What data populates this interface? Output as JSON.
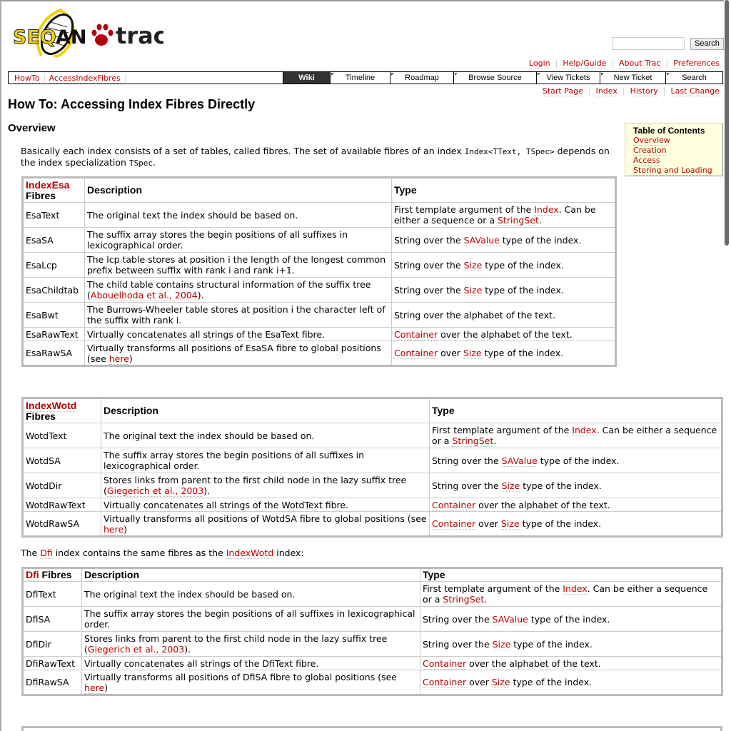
{
  "logo": {
    "text": "SEQAN trac",
    "colors": {
      "yellow": "#f5d000",
      "red": "#b5000d"
    }
  },
  "header": {
    "search_placeholder": "",
    "search_button": "Search"
  },
  "metanav": [
    "Login",
    "Help/Guide",
    "About Trac",
    "Preferences"
  ],
  "breadcrumbs": [
    "HowTo",
    "AccessIndexFibres"
  ],
  "mainnav": [
    {
      "label": "Wiki",
      "active": true
    },
    {
      "label": "Timeline"
    },
    {
      "label": "Roadmap"
    },
    {
      "label": "Browse Source"
    },
    {
      "label": "View Tickets"
    },
    {
      "label": "New Ticket"
    },
    {
      "label": "Search"
    }
  ],
  "ctxnav": [
    "Start Page",
    "Index",
    "History",
    "Last Change"
  ],
  "page": {
    "title": "How To: Accessing Index Fibres Directly",
    "section": "Overview"
  },
  "toc": {
    "title": "Table of Contents",
    "items": [
      "Overview",
      "Creation",
      "Access",
      "Storing and Loading"
    ]
  },
  "intro": [
    {
      "t": "Basically each index consists of a set of tables, called fibres. The set of available fibres of an index "
    },
    {
      "c": "Index<TText, TSpec>"
    },
    {
      "t": " depends on the index specialization "
    },
    {
      "c": "TSpec"
    },
    {
      "t": "."
    }
  ],
  "between": [
    {
      "t": "The "
    },
    {
      "l": "Dfi"
    },
    {
      "t": " index contains the same fibres as the "
    },
    {
      "l": "IndexWotd"
    },
    {
      "t": " index:"
    }
  ],
  "tables": [
    {
      "head": [
        [
          {
            "l": "IndexEsa"
          },
          {
            "br": 1
          },
          {
            "t": "Fibres"
          }
        ],
        [
          {
            "t": "Description"
          }
        ],
        [
          {
            "t": "Type"
          }
        ]
      ],
      "rows": [
        [
          [
            {
              "t": "EsaText"
            }
          ],
          [
            {
              "t": "The original text the index should be based on."
            }
          ],
          [
            {
              "t": "First template argument of the "
            },
            {
              "l": "Index"
            },
            {
              "t": ". Can be either a sequence or a "
            },
            {
              "l": "StringSet"
            },
            {
              "t": "."
            }
          ]
        ],
        [
          [
            {
              "t": "EsaSA"
            }
          ],
          [
            {
              "t": "The suffix array stores the begin positions of all suffixes in lexicographical order."
            }
          ],
          [
            {
              "t": "String over the "
            },
            {
              "l": "SAValue"
            },
            {
              "t": " type of the index."
            }
          ]
        ],
        [
          [
            {
              "t": "EsaLcp"
            }
          ],
          [
            {
              "t": "The lcp table stores at position i the length of the longest common prefix between suffix with rank i and rank i+1."
            }
          ],
          [
            {
              "t": "String over the "
            },
            {
              "l": "Size"
            },
            {
              "t": " type of the index."
            }
          ]
        ],
        [
          [
            {
              "t": "EsaChildtab"
            }
          ],
          [
            {
              "t": "The child table contains structural information of the suffix tree ("
            },
            {
              "l": "Abouelhoda et al., 2004"
            },
            {
              "t": ")."
            }
          ],
          [
            {
              "t": "String over the "
            },
            {
              "l": "Size"
            },
            {
              "t": " type of the index."
            }
          ]
        ],
        [
          [
            {
              "t": "EsaBwt"
            }
          ],
          [
            {
              "t": "The Burrows-Wheeler table stores at position i the character left of the suffix with rank i."
            }
          ],
          [
            {
              "t": "String over the alphabet of the text."
            }
          ]
        ],
        [
          [
            {
              "t": "EsaRawText"
            }
          ],
          [
            {
              "t": "Virtually concatenates all strings of the EsaText fibre."
            }
          ],
          [
            {
              "l": "Container"
            },
            {
              "t": " over the alphabet of the text."
            }
          ]
        ],
        [
          [
            {
              "t": "EsaRawSA"
            }
          ],
          [
            {
              "t": "Virtually transforms all positions of EsaSA fibre to global positions (see "
            },
            {
              "l": "here"
            },
            {
              "t": ")"
            }
          ],
          [
            {
              "l": "Container"
            },
            {
              "t": " over "
            },
            {
              "l": "Size"
            },
            {
              "t": " type of the index."
            }
          ]
        ]
      ]
    },
    {
      "head": [
        [
          {
            "l": "IndexWotd"
          },
          {
            "br": 1
          },
          {
            "t": "Fibres"
          }
        ],
        [
          {
            "t": "Description"
          }
        ],
        [
          {
            "t": "Type"
          }
        ]
      ],
      "rows": [
        [
          [
            {
              "t": "WotdText"
            }
          ],
          [
            {
              "t": "The original text the index should be based on."
            }
          ],
          [
            {
              "t": "First template argument of the "
            },
            {
              "l": "Index"
            },
            {
              "t": ". Can be either a sequence or a "
            },
            {
              "l": "StringSet"
            },
            {
              "t": "."
            }
          ]
        ],
        [
          [
            {
              "t": "WotdSA"
            }
          ],
          [
            {
              "t": "The suffix array stores the begin positions of all suffixes in lexicographical order."
            }
          ],
          [
            {
              "t": "String over the "
            },
            {
              "l": "SAValue"
            },
            {
              "t": " type of the index."
            }
          ]
        ],
        [
          [
            {
              "t": "WotdDir"
            }
          ],
          [
            {
              "t": "Stores links from parent to the first child node in the lazy suffix tree ("
            },
            {
              "l": "Giegerich et al., 2003"
            },
            {
              "t": ")."
            }
          ],
          [
            {
              "t": "String over the "
            },
            {
              "l": "Size"
            },
            {
              "t": " type of the index."
            }
          ]
        ],
        [
          [
            {
              "t": "WotdRawText"
            }
          ],
          [
            {
              "t": "Virtually concatenates all strings of the WotdText fibre."
            }
          ],
          [
            {
              "l": "Container"
            },
            {
              "t": " over the alphabet of the text."
            }
          ]
        ],
        [
          [
            {
              "t": "WotdRawSA"
            }
          ],
          [
            {
              "t": "Virtually transforms all positions of WotdSA fibre to global positions (see "
            },
            {
              "l": "here"
            },
            {
              "t": ")"
            }
          ],
          [
            {
              "l": "Container"
            },
            {
              "t": " over "
            },
            {
              "l": "Size"
            },
            {
              "t": " type of the index."
            }
          ]
        ]
      ]
    },
    {
      "head": [
        [
          {
            "l": "Dfi"
          },
          {
            "t": " Fibres"
          }
        ],
        [
          {
            "t": "Description"
          }
        ],
        [
          {
            "t": "Type"
          }
        ]
      ],
      "rows": [
        [
          [
            {
              "t": "DfiText"
            }
          ],
          [
            {
              "t": "The original text the index should be based on."
            }
          ],
          [
            {
              "t": "First template argument of the "
            },
            {
              "l": "Index"
            },
            {
              "t": ". Can be either a sequence or a "
            },
            {
              "l": "StringSet"
            },
            {
              "t": "."
            }
          ]
        ],
        [
          [
            {
              "t": "DfiSA"
            }
          ],
          [
            {
              "t": "The suffix array stores the begin positions of all suffixes in lexicographical order."
            }
          ],
          [
            {
              "t": "String over the "
            },
            {
              "l": "SAValue"
            },
            {
              "t": " type of the index."
            }
          ]
        ],
        [
          [
            {
              "t": "DfiDir"
            }
          ],
          [
            {
              "t": "Stores links from parent to the first child node in the lazy suffix tree ("
            },
            {
              "l": "Giegerich et al., 2003"
            },
            {
              "t": ")."
            }
          ],
          [
            {
              "t": "String over the "
            },
            {
              "l": "Size"
            },
            {
              "t": " type of the index."
            }
          ]
        ],
        [
          [
            {
              "t": "DfiRawText"
            }
          ],
          [
            {
              "t": "Virtually concatenates all strings of the DfiText fibre."
            }
          ],
          [
            {
              "l": "Container"
            },
            {
              "t": " over the alphabet of the text."
            }
          ]
        ],
        [
          [
            {
              "t": "DfiRawSA"
            }
          ],
          [
            {
              "t": "Virtually transforms all positions of DfiSA fibre to global positions (see "
            },
            {
              "l": "here"
            },
            {
              "t": ")"
            }
          ],
          [
            {
              "l": "Container"
            },
            {
              "t": " over "
            },
            {
              "l": "Size"
            },
            {
              "t": " type of the index."
            }
          ]
        ]
      ]
    }
  ]
}
